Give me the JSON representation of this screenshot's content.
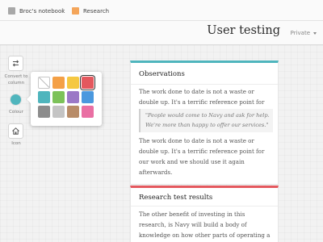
{
  "breadcrumbs": [
    {
      "label": "Broc's notebook",
      "color": "#a8a8a8"
    },
    {
      "label": "Research",
      "color": "#f4a55a"
    }
  ],
  "breadcrumb_separator": "›",
  "header": {
    "title": "User testing",
    "privacy": "Private"
  },
  "toolbar": {
    "convert_label": "Convert to column",
    "colour_label": "Colour",
    "colour_value": "#4fb5bd",
    "icon_label": "Icon"
  },
  "colour_picker": {
    "swatches": [
      {
        "name": "none",
        "color": "#ffffff"
      },
      {
        "name": "orange",
        "color": "#f4a046"
      },
      {
        "name": "yellow",
        "color": "#f5c842"
      },
      {
        "name": "red",
        "color": "#e4585e",
        "selected": true
      },
      {
        "name": "teal",
        "color": "#4fb5bd"
      },
      {
        "name": "green",
        "color": "#7cc259"
      },
      {
        "name": "purple",
        "color": "#9b78c6"
      },
      {
        "name": "blue",
        "color": "#4a98de"
      },
      {
        "name": "dark-grey",
        "color": "#8c8c8c"
      },
      {
        "name": "light-grey",
        "color": "#c4c4c4"
      },
      {
        "name": "brown",
        "color": "#b88c68"
      },
      {
        "name": "pink",
        "color": "#e96fa3"
      }
    ]
  },
  "cards": [
    {
      "title": "Observations",
      "accent": "#4fb5bd",
      "para1": "The work done to date is not a waste or double up. It's a terrific reference point for our work.",
      "quote": "\"People would come to Navy and ask for help. We're more than happy to offer our services.\"",
      "para2": "The work done to date is not a waste or double up. It's a terrific reference point for our work and we should use it again afterwards."
    },
    {
      "title": "Research test results",
      "accent": "#e4585e",
      "para1": "The other benefit of investing in this research, is Navy will build a body of knowledge on how other parts of operating a pharmacy work that"
    }
  ]
}
